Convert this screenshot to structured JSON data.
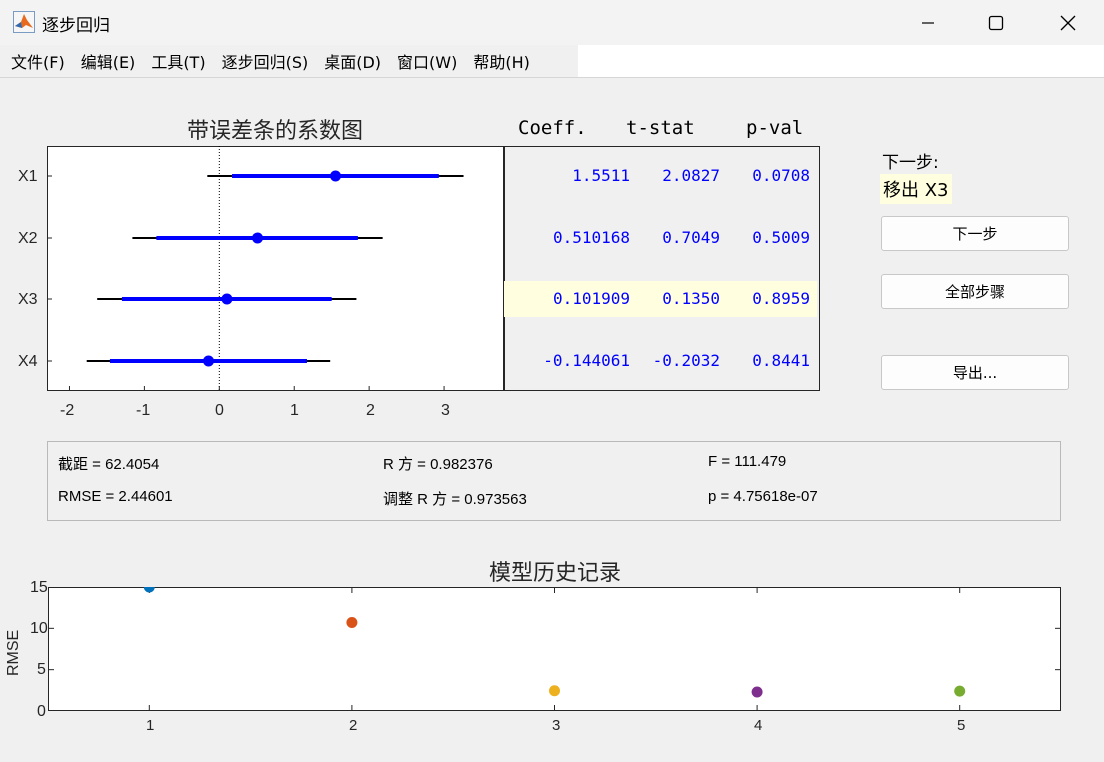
{
  "window": {
    "title": "逐步回归",
    "controls": {
      "minimize": "minimize",
      "maximize": "maximize",
      "close": "close"
    }
  },
  "menu": [
    "文件(F)",
    "编辑(E)",
    "工具(T)",
    "逐步回归(S)",
    "桌面(D)",
    "窗口(W)",
    "帮助(H)"
  ],
  "coef_plot": {
    "title": "带误差条的系数图",
    "x_ticks": [
      "-2",
      "-1",
      "0",
      "1",
      "2",
      "3"
    ],
    "y_ticks": [
      "X1",
      "X2",
      "X3",
      "X4"
    ]
  },
  "coef_table": {
    "headers": [
      "Coeff.",
      "t-stat",
      "p-val"
    ],
    "rows": [
      {
        "coeff": "1.5511",
        "tstat": "2.0827",
        "pval": "0.0708"
      },
      {
        "coeff": "0.510168",
        "tstat": "0.7049",
        "pval": "0.5009"
      },
      {
        "coeff": "0.101909",
        "tstat": "0.1350",
        "pval": "0.8959"
      },
      {
        "coeff": "-0.144061",
        "tstat": "-0.2032",
        "pval": "0.8441"
      }
    ]
  },
  "next_step": {
    "label": "下一步:",
    "action": "移出 X3",
    "buttons": {
      "next": "下一步",
      "all": "全部步骤",
      "export": "导出..."
    }
  },
  "stats": {
    "intercept": "截距 = 62.4054",
    "rsq": "R 方 = 0.982376",
    "f": "F = 111.479",
    "rmse": "RMSE = 2.44601",
    "adj_rsq": "调整 R 方 = 0.973563",
    "p": "p = 4.75618e-07"
  },
  "history_plot": {
    "title": "模型历史记录",
    "ylabel": "RMSE",
    "x_ticks": [
      "1",
      "2",
      "3",
      "4",
      "5"
    ],
    "y_ticks": [
      "0",
      "5",
      "10",
      "15"
    ]
  },
  "chart_data": [
    {
      "type": "scatter",
      "title": "带误差条的系数图",
      "categories": [
        "X1",
        "X2",
        "X3",
        "X4"
      ],
      "estimate": [
        1.5511,
        0.510168,
        0.101909,
        -0.144061
      ],
      "ci_inner": [
        [
          0.17,
          2.93
        ],
        [
          -0.84,
          1.85
        ],
        [
          -1.3,
          1.5
        ],
        [
          -1.46,
          1.17
        ]
      ],
      "ci_outer": [
        [
          -0.16,
          3.26
        ],
        [
          -1.16,
          2.18
        ],
        [
          -1.63,
          1.83
        ],
        [
          -1.77,
          1.48
        ]
      ],
      "xlim": [
        -2.3,
        3.8
      ],
      "reference_line_x": 0,
      "colors": {
        "estimate": "#0000ff",
        "outer": "#000000"
      }
    },
    {
      "type": "scatter",
      "title": "模型历史记录",
      "ylabel": "RMSE",
      "x": [
        1,
        2,
        3,
        4,
        5
      ],
      "y": [
        15.0,
        10.7,
        2.45,
        2.3,
        2.4
      ],
      "xlim": [
        0.5,
        5.5
      ],
      "ylim": [
        0,
        15
      ],
      "colors": [
        "#0072bd",
        "#d95319",
        "#edb120",
        "#7e2f8e",
        "#77ac30"
      ]
    }
  ]
}
